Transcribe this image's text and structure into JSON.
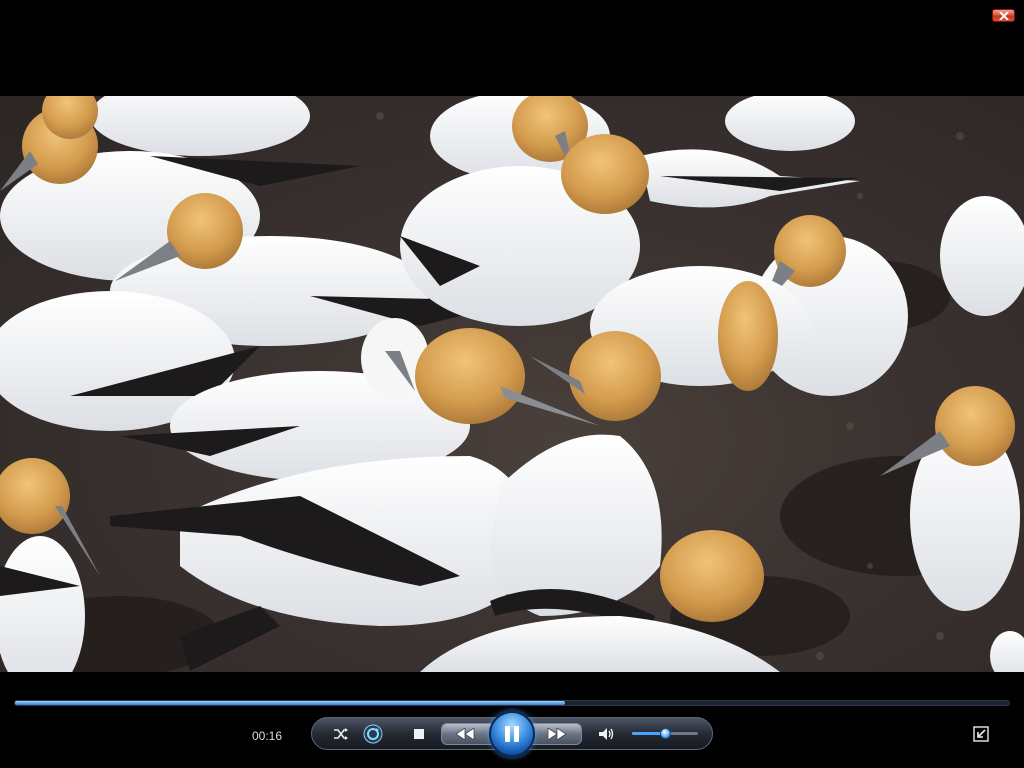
{
  "player": {
    "current_time": "00:16",
    "seek_progress": 0.553,
    "volume_level": 0.5,
    "state": "playing"
  },
  "icons": {
    "close": "close-icon",
    "shuffle": "shuffle-icon",
    "repeat": "repeat-icon",
    "stop": "stop-icon",
    "previous": "rewind-icon",
    "play_pause": "pause-icon",
    "next": "fast-forward-icon",
    "mute": "speaker-icon",
    "fullscreen": "exit-fullscreen-icon"
  },
  "colors": {
    "accent": "#3f8fe0",
    "background": "#000000",
    "close_button": "#d9533b",
    "video_ground": "#3a3230",
    "gannet_body": "#ffffff",
    "gannet_head": "#d8a352"
  },
  "video": {
    "description_icon": "video-frame-gannets"
  }
}
